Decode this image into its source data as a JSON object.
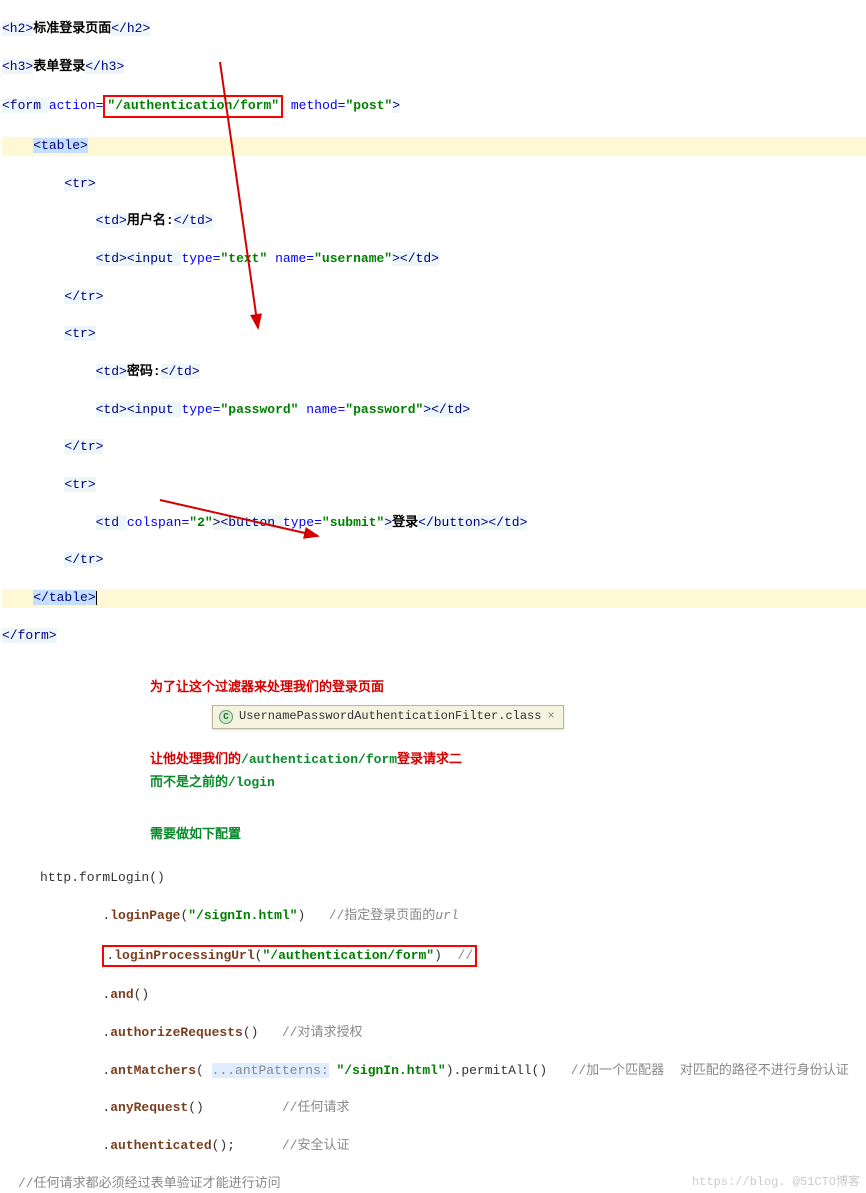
{
  "html_code": {
    "h2_text": "标准登录页面",
    "h3_text": "表单登录",
    "form_action": "\"/authentication/form\"",
    "form_method": "\"post\"",
    "label_user": "用户名:",
    "label_pass": "密码:",
    "input_type_text": "\"text\"",
    "input_name_user": "\"username\"",
    "input_type_pass": "\"password\"",
    "input_name_pass": "\"password\"",
    "td_colspan": "\"2\"",
    "button_type": "\"submit\"",
    "button_text": "登录"
  },
  "annotations": {
    "intro": "为了让这个过滤器来处理我们的登录页面",
    "class_name": "UsernamePasswordAuthenticationFilter.class",
    "req_line_prefix": "让他处理我们的",
    "req_path": "/authentication/form",
    "req_suffix": "登录请求二",
    "not_line_prefix": "而不是之前的",
    "not_path": "/login",
    "need_config": "需要做如下配置"
  },
  "java_code": {
    "root": "http.formLogin()",
    "l1_method": "loginPage",
    "l1_arg": "\"/signIn.html\"",
    "l1_cmt": "//指定登录页面的",
    "l1_cmt_it": "url",
    "l2_method": "loginProcessingUrl",
    "l2_arg": "\"/authentication/form\"",
    "l2_cmt": "//",
    "l3_method": "and",
    "l4_method": "authorizeRequests",
    "l4_cmt": "//对请求授权",
    "l5_method": "antMatchers",
    "l5_param_label": "...antPatterns:",
    "l5_arg": "\"/signIn.html\"",
    "l5_chain": ".permitAll()",
    "l5_cmt": "//加一个匹配器  对匹配的路径不进行身份认证",
    "l6_method": "anyRequest",
    "l6_cmt": "//任何请求",
    "l7_method": "authenticated",
    "l7_cmt": "//安全认证",
    "bottom_cmt": "//任何请求都必须经过表单验证才能进行访问"
  },
  "watermark": "https://blog. @51CTO博客"
}
